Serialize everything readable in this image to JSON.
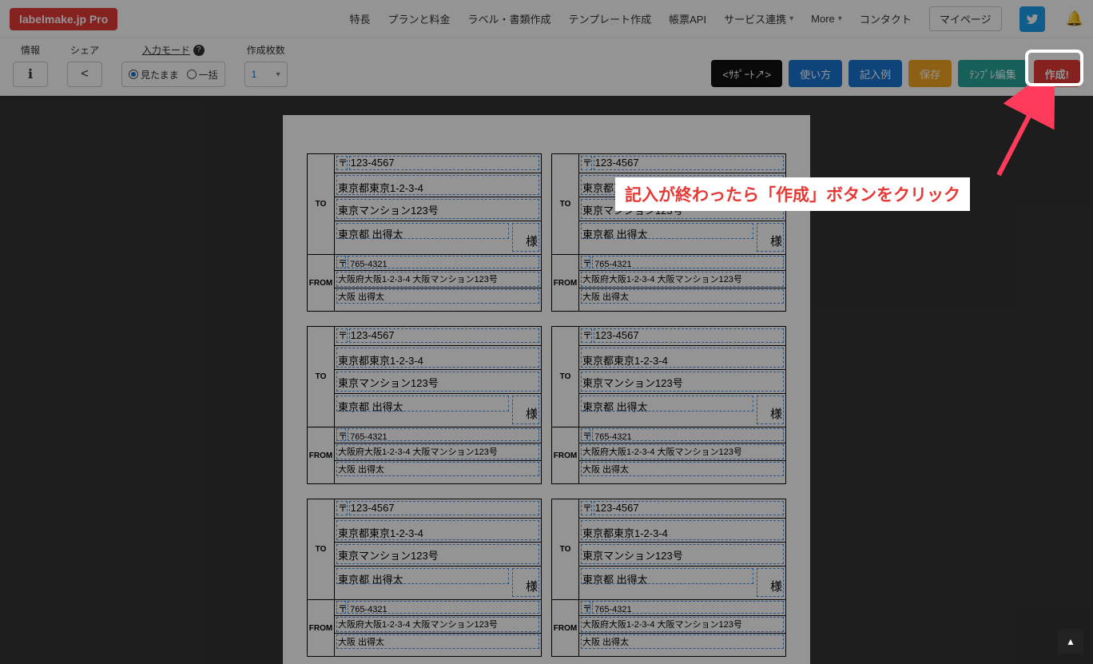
{
  "header": {
    "logo": "labelmake.jp Pro",
    "nav": [
      "特長",
      "プランと料金",
      "ラベル・書類作成",
      "テンプレート作成",
      "帳票API",
      "サービス連携",
      "More"
    ],
    "contact": "コンタクト",
    "mypage": "マイページ"
  },
  "toolbar": {
    "info_label": "情報",
    "share_label": "シェア",
    "mode_label": "入力モード",
    "mode_opts": {
      "a": "見たまま",
      "b": "一括"
    },
    "count_label": "作成枚数",
    "count_value": "1",
    "buttons": {
      "support": "<ｻﾎﾟｰﾄ↗>",
      "howto": "使い方",
      "example": "記入例",
      "save": "保存",
      "edit_tpl": "ﾃﾝﾌﾟﾚ編集",
      "create": "作成!"
    }
  },
  "label": {
    "to_marker": "TO",
    "from_marker": "FROM",
    "postal_mark": "〒",
    "to_postal": "123-4567",
    "to_addr1": "東京都東京1-2-3-4",
    "to_addr2": "東京マンション123号",
    "to_name": "東京都 出得太",
    "sama": "様",
    "from_postal": "765-4321",
    "from_addr": "大阪府大阪1-2-3-4 大阪マンション123号",
    "from_name": "大阪 出得太"
  },
  "callout": "記入が終わったら「作成」ボタンをクリック"
}
